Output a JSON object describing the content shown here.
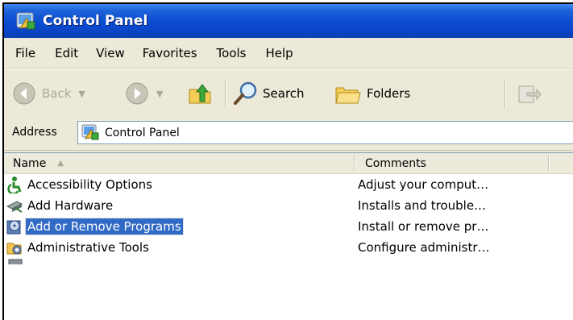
{
  "window": {
    "title": "Control Panel"
  },
  "menu": [
    "File",
    "Edit",
    "View",
    "Favorites",
    "Tools",
    "Help"
  ],
  "toolbar": {
    "back_label": "Back",
    "search_label": "Search",
    "folders_label": "Folders"
  },
  "address": {
    "label": "Address",
    "value": "Control Panel"
  },
  "list": {
    "columns": [
      {
        "label": "Name",
        "sort": "ascending"
      },
      {
        "label": "Comments"
      }
    ],
    "rows": [
      {
        "name": "Accessibility Options",
        "comment": "Adjust your comput…",
        "icon": "accessibility-icon",
        "selected": false
      },
      {
        "name": "Add Hardware",
        "comment": "Installs and trouble…",
        "icon": "add-hardware-icon",
        "selected": false
      },
      {
        "name": "Add or Remove Programs",
        "comment": "Install or remove pr…",
        "icon": "add-remove-programs-icon",
        "selected": true
      },
      {
        "name": "Administrative Tools",
        "comment": "Configure administr…",
        "icon": "administrative-tools-icon",
        "selected": false
      }
    ]
  },
  "colors": {
    "title_bar": "#0a4bd0",
    "selection": "#316ac5",
    "chrome": "#ece9d8"
  }
}
